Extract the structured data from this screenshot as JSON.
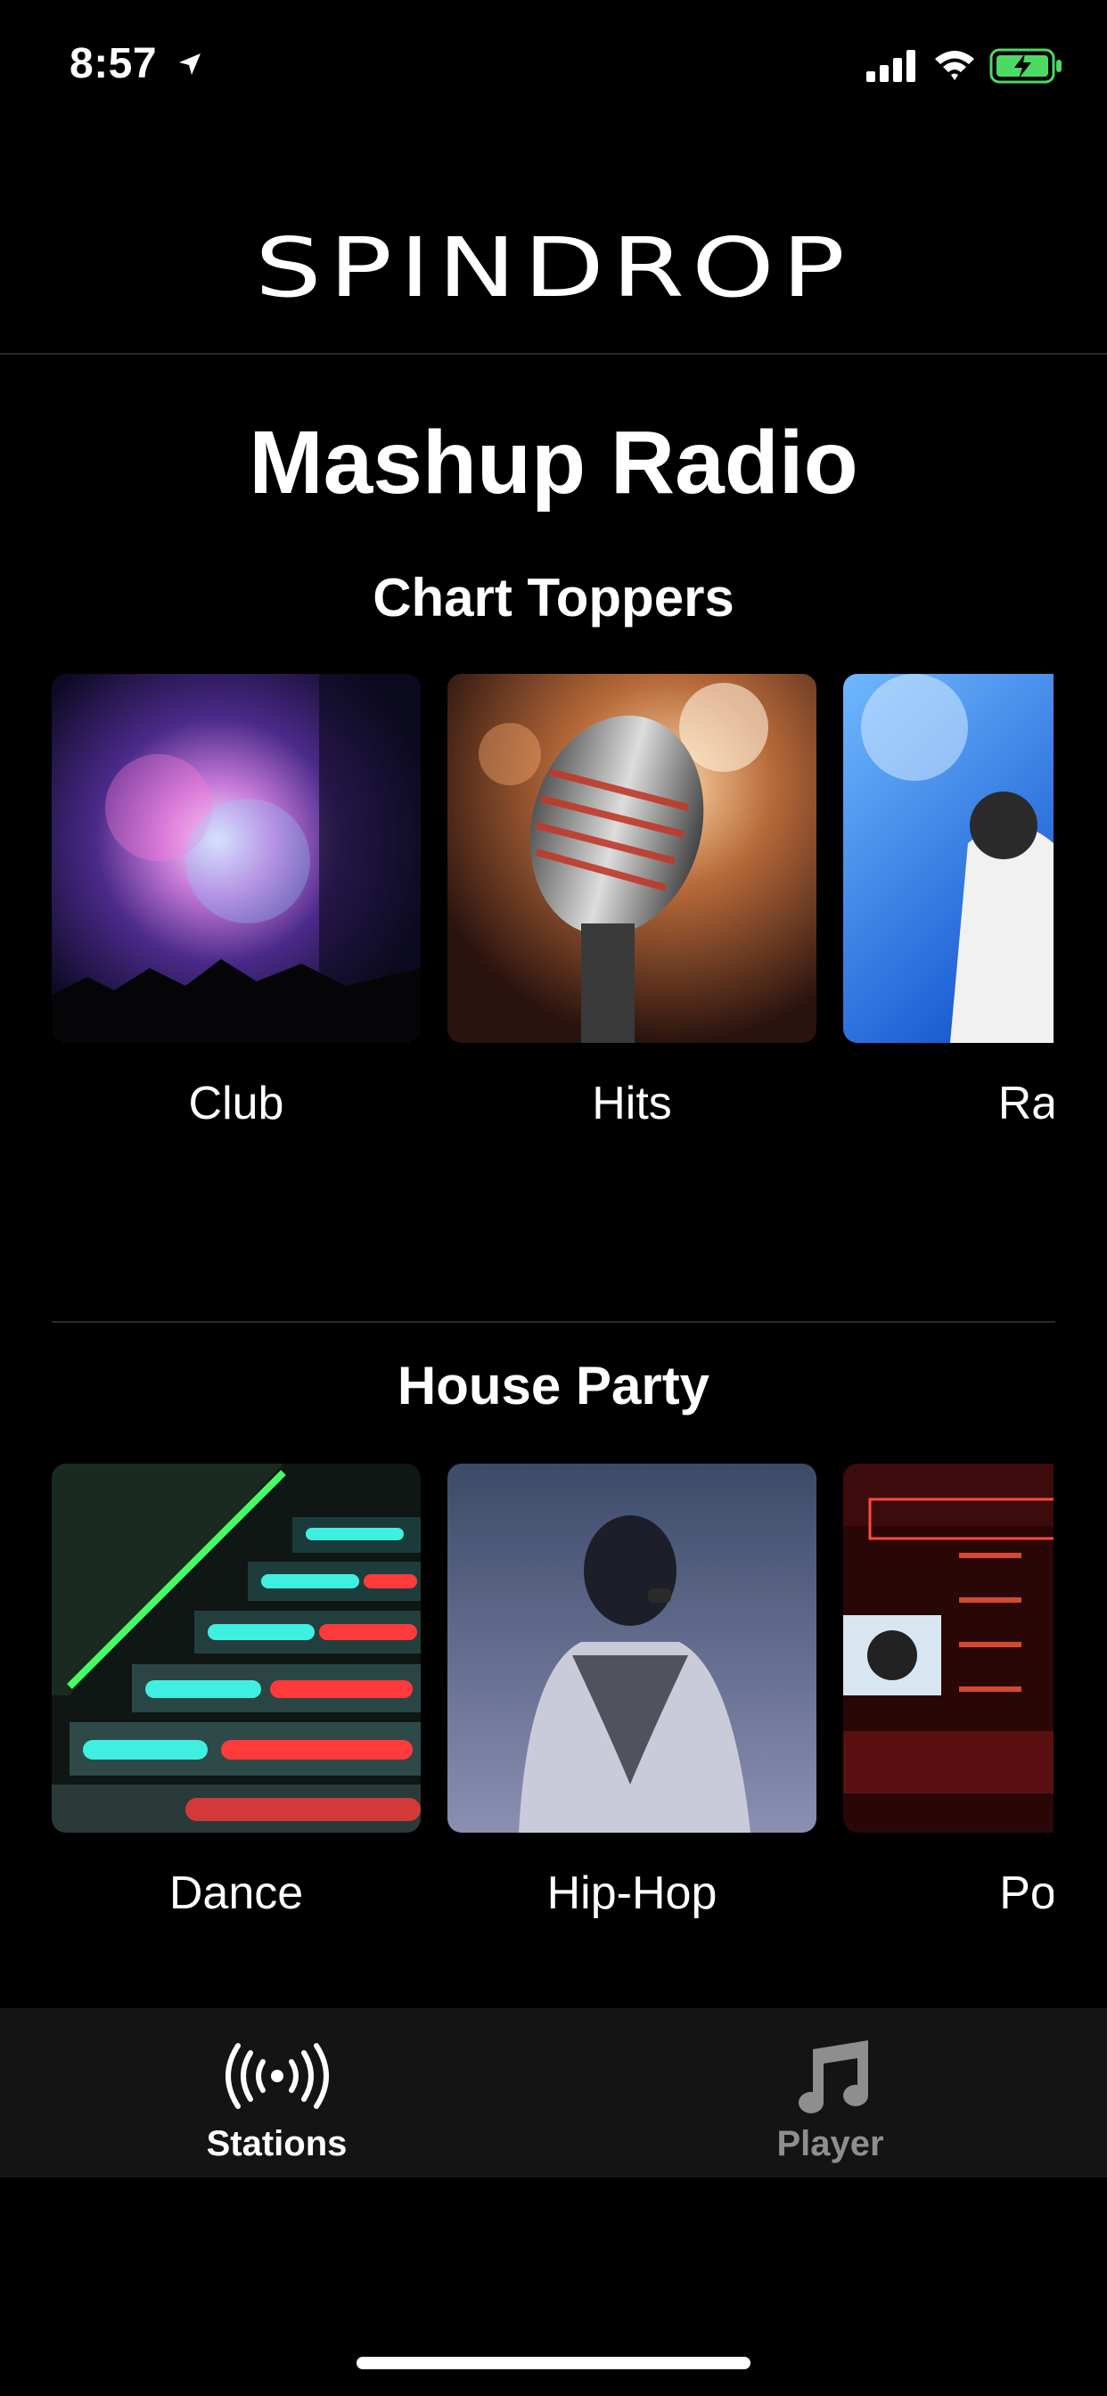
{
  "status_bar": {
    "time": "8:57"
  },
  "header": {
    "logo": "SPINDROP"
  },
  "page": {
    "title": "Mashup Radio"
  },
  "sections": [
    {
      "title": "Chart Toppers",
      "stations": [
        {
          "label": "Club"
        },
        {
          "label": "Hits"
        },
        {
          "label": "Ra"
        }
      ]
    },
    {
      "title": "House Party",
      "stations": [
        {
          "label": "Dance"
        },
        {
          "label": "Hip-Hop"
        },
        {
          "label": "Po"
        }
      ]
    }
  ],
  "tabs": [
    {
      "label": "Stations",
      "icon": "broadcast-icon",
      "active": true
    },
    {
      "label": "Player",
      "icon": "music-note-icon",
      "active": false
    }
  ],
  "colors": {
    "background": "#000000",
    "tab_bar": "#141414",
    "tab_active": "#ffffff",
    "tab_inactive": "#8e8e8e",
    "battery": "#4cd964"
  }
}
